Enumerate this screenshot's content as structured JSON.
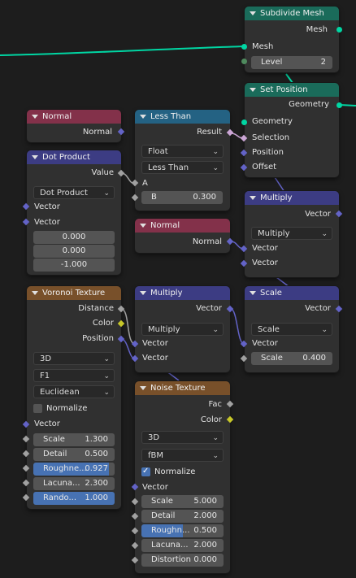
{
  "colors": {
    "converter_header": "#1a6b5a",
    "input_header": "#83314a",
    "utility_header": "#246283",
    "vector_header": "#3c3c83",
    "texture_header": "#78502a",
    "wire_green": "#00d6a3",
    "wire_pink": "#cca6d6",
    "wire_blue": "#6363c7",
    "slider_fill": "#4772b3"
  },
  "subdivide": {
    "title": "Subdivide Mesh",
    "out_mesh": "Mesh",
    "in_mesh": "Mesh",
    "level_label": "Level",
    "level_value": "2"
  },
  "setpos": {
    "title": "Set Position",
    "out_geometry": "Geometry",
    "in_geometry": "Geometry",
    "in_selection": "Selection",
    "in_position": "Position",
    "in_offset": "Offset"
  },
  "normal1": {
    "title": "Normal",
    "out_normal": "Normal"
  },
  "dot": {
    "title": "Dot Product",
    "out_value": "Value",
    "mode": "Dot Product",
    "in_vector_a": "Vector",
    "in_vector_b": "Vector",
    "vec": [
      "0.000",
      "0.000",
      "-1.000"
    ]
  },
  "lessthan": {
    "title": "Less Than",
    "out_result": "Result",
    "type": "Float",
    "mode": "Less Than",
    "in_a": "A",
    "b_label": "B",
    "b_value": "0.300"
  },
  "multiply1": {
    "title": "Multiply",
    "out_vector": "Vector",
    "mode": "Multiply",
    "in_vector_a": "Vector",
    "in_vector_b": "Vector"
  },
  "normal2": {
    "title": "Normal",
    "out_normal": "Normal"
  },
  "voronoi": {
    "title": "Voronoi Texture",
    "out_distance": "Distance",
    "out_color": "Color",
    "out_position": "Position",
    "dimension": "3D",
    "feature": "F1",
    "metric": "Euclidean",
    "normalize_label": "Normalize",
    "normalize_checked": false,
    "in_vector": "Vector",
    "fields": [
      {
        "label": "Scale",
        "value": "1.300"
      },
      {
        "label": "Detail",
        "value": "0.500"
      },
      {
        "label": "Roughne...",
        "value": "0.927",
        "fill": 0.927
      },
      {
        "label": "Lacuna...",
        "value": "2.300"
      },
      {
        "label": "Rando...",
        "value": "1.000",
        "fill": 1.0
      }
    ]
  },
  "multiply2": {
    "title": "Multiply",
    "out_vector": "Vector",
    "mode": "Multiply",
    "in_vector_a": "Vector",
    "in_vector_b": "Vector"
  },
  "scale": {
    "title": "Scale",
    "out_vector": "Vector",
    "mode": "Scale",
    "in_vector": "Vector",
    "scale_label": "Scale",
    "scale_value": "0.400"
  },
  "noise": {
    "title": "Noise Texture",
    "out_fac": "Fac",
    "out_color": "Color",
    "dimension": "3D",
    "type": "fBM",
    "normalize_label": "Normalize",
    "normalize_checked": true,
    "in_vector": "Vector",
    "fields": [
      {
        "label": "Scale",
        "value": "5.000"
      },
      {
        "label": "Detail",
        "value": "2.000"
      },
      {
        "label": "Roughn...",
        "value": "0.500",
        "fill": 0.5
      },
      {
        "label": "Lacuna...",
        "value": "2.000"
      },
      {
        "label": "Distortion",
        "value": "0.000"
      }
    ]
  }
}
